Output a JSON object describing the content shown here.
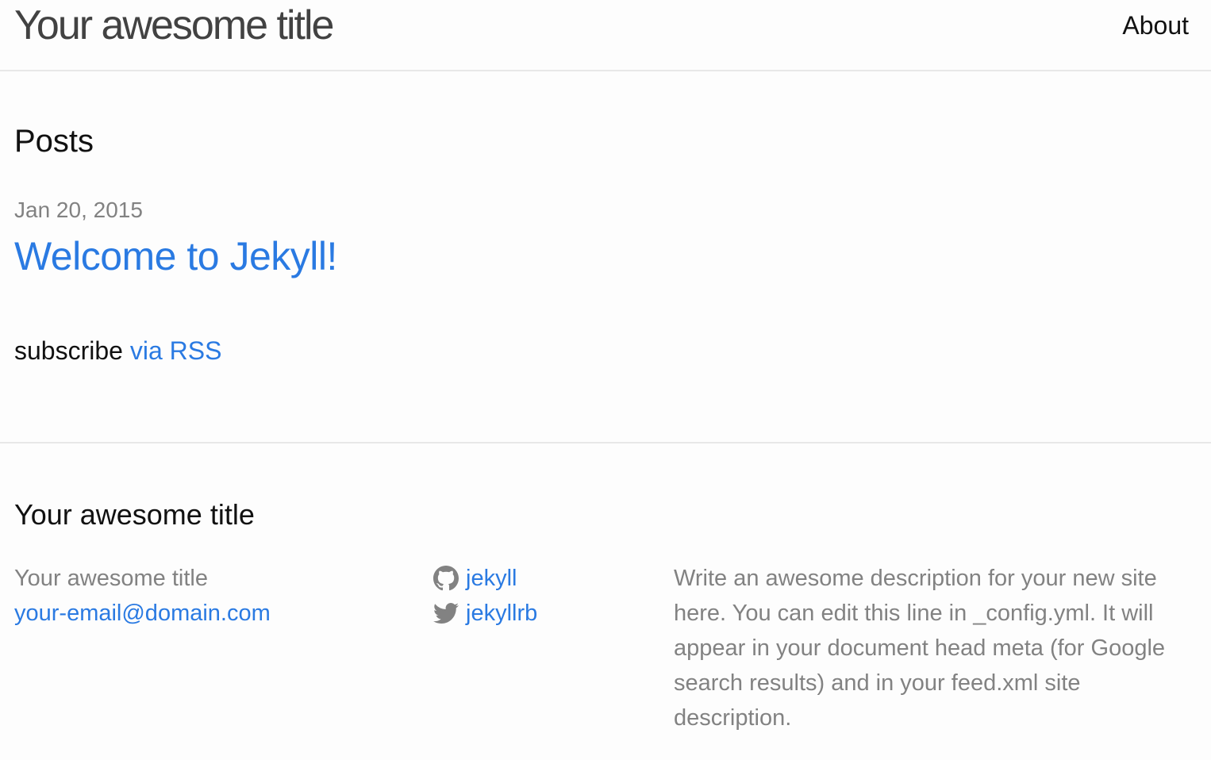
{
  "header": {
    "site_title": "Your awesome title",
    "nav": [
      {
        "label": "About"
      }
    ]
  },
  "main": {
    "heading": "Posts",
    "posts": [
      {
        "date": "Jan 20, 2015",
        "title": "Welcome to Jekyll!"
      }
    ],
    "rss": {
      "prefix": "subscribe",
      "link_label": "via RSS"
    }
  },
  "footer": {
    "heading": "Your awesome title",
    "name": "Your awesome title",
    "email": "your-email@domain.com",
    "social": [
      {
        "icon": "github-icon",
        "label": "jekyll"
      },
      {
        "icon": "twitter-icon",
        "label": "jekyllrb"
      }
    ],
    "description": "Write an awesome description for your new site here. You can edit this line in _config.yml. It will appear in your document head meta (for Google search results) and in your feed.xml site description."
  },
  "colors": {
    "link": "#2a7ae2",
    "muted": "#828282",
    "text": "#111111",
    "title": "#424242",
    "border": "#e8e8e8",
    "background": "#fdfdfd"
  }
}
